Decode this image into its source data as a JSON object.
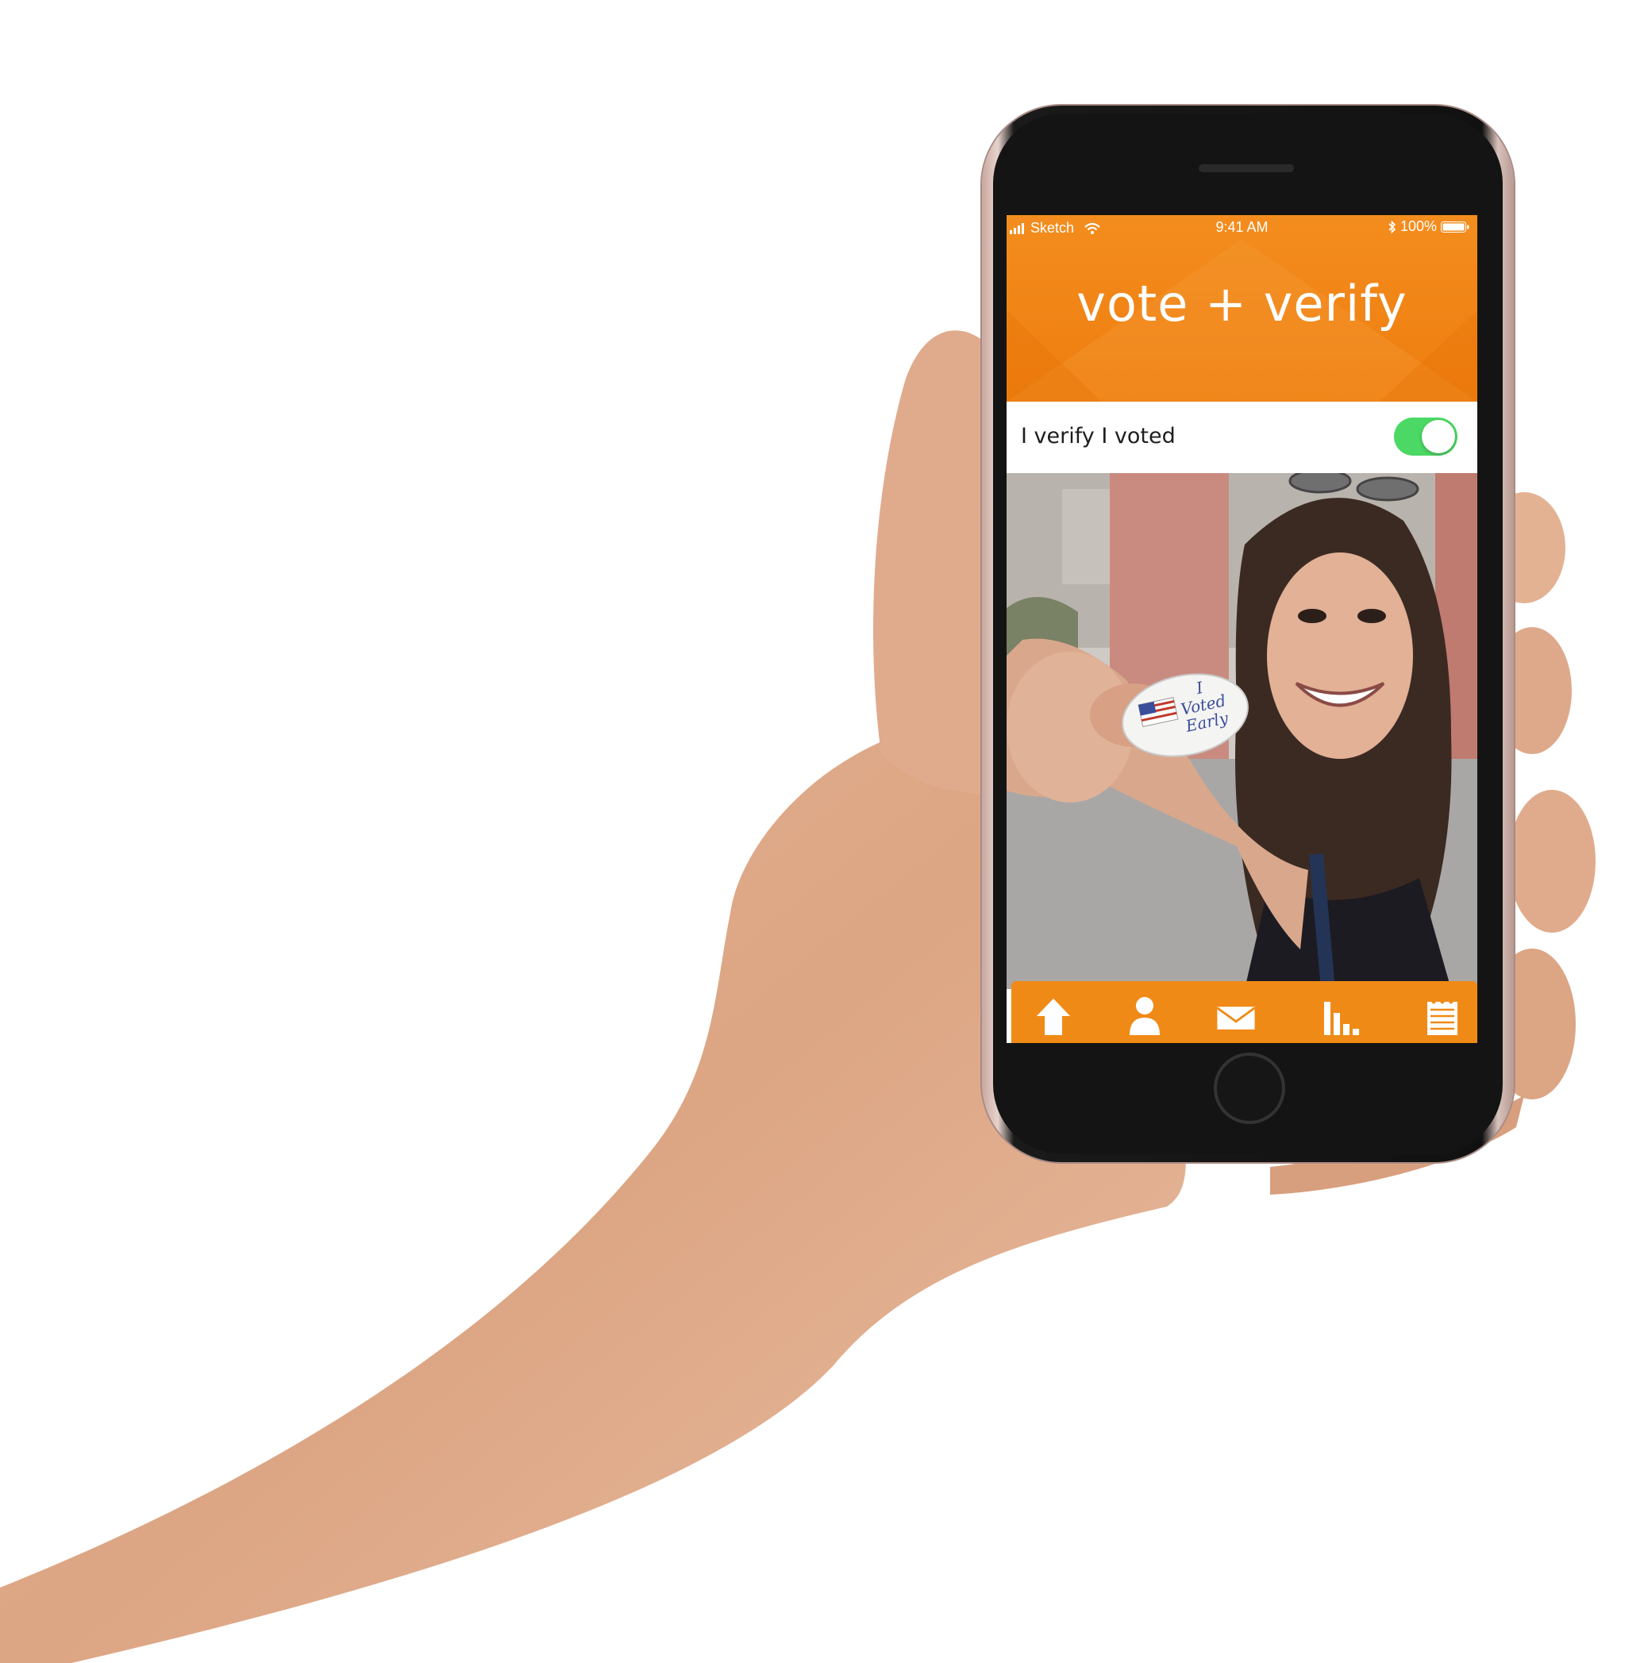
{
  "status_bar": {
    "carrier": "Sketch",
    "time": "9:41 AM",
    "battery": "100%"
  },
  "header": {
    "title": "vote + verify"
  },
  "verify": {
    "label": "I verify I voted",
    "toggle_on": true
  },
  "photo": {
    "sticker_lines": [
      "I",
      "Voted",
      "Early"
    ]
  },
  "tab_bar": {
    "tabs": [
      {
        "icon": "home-icon"
      },
      {
        "icon": "profile-icon"
      },
      {
        "icon": "mail-icon"
      },
      {
        "icon": "bar-chart-icon"
      },
      {
        "icon": "notepad-icon"
      }
    ]
  },
  "colors": {
    "brand_orange": "#ef7d0f",
    "toggle_green": "#4bd864"
  }
}
